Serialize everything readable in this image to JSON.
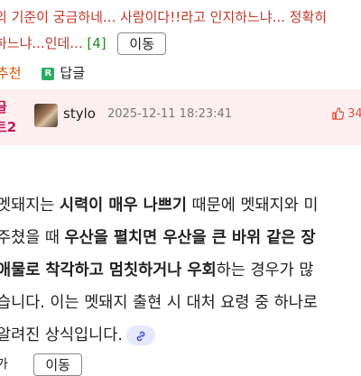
{
  "quoted_comment": {
    "line1": "의 기준이 궁금하네... 사람이다!!라고 인지하느냐... 정확히",
    "line2_text": "하느냐...인데...",
    "reply_count": "[4]",
    "move_label": "이동"
  },
  "actions": {
    "recommend_label": "추천",
    "reply_badge": "R",
    "reply_label": "답글"
  },
  "comment": {
    "tag_line1": "글",
    "tag_line2": "트2",
    "username": "stylo",
    "timestamp": "2025-12-11 18:23:41",
    "like_count": "34",
    "body": {
      "l1a": "멧돼지는 ",
      "l1b": "시력이 매우 나쁘기",
      "l1c": " 때문에 멧돼지와 미",
      "l2a": "주쳤을 때 ",
      "l2b": "우산을 펼치면 우산을 큰 바위 같은 장",
      "l3a": "애물로 착각하고 멈칫하거나 우회",
      "l3b": "하는 경우가 많",
      "l4": "습니다. 이는 멧돼지 출현 시 대처 요령 중 하나로",
      "l5": "알려진 상식입니다."
    }
  },
  "bottom": {
    "partial_label": "가",
    "move_label": "이동"
  },
  "colors": {
    "accent_red": "#c0392b",
    "header_bg": "#fdeef0",
    "tag_color": "#c2185b",
    "reply_green": "#27ae60",
    "link_chip_bg": "#e6e9ff"
  },
  "icons": [
    "thumbs-up-icon",
    "link-icon",
    "reply-badge-icon"
  ]
}
